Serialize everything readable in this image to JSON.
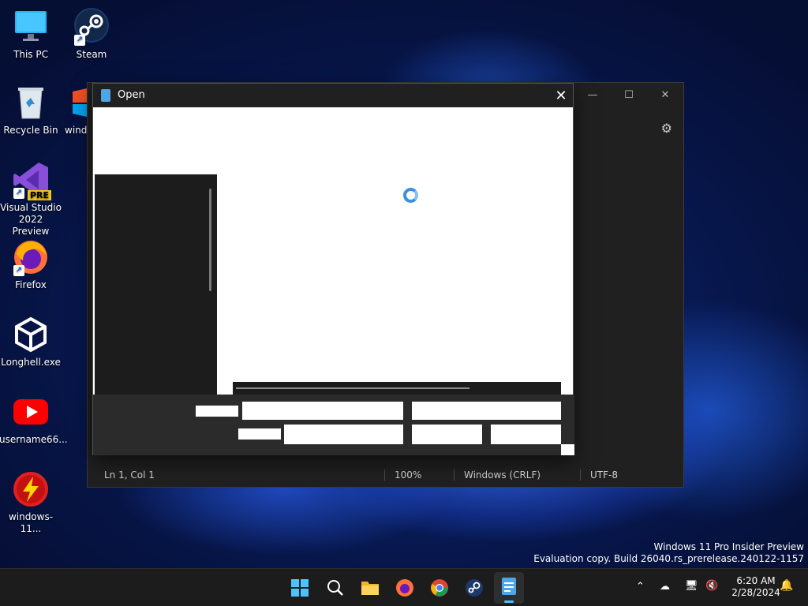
{
  "desktop": {
    "icons": [
      {
        "label": "This PC",
        "icon": "monitor-icon"
      },
      {
        "label": "Steam",
        "icon": "steam-icon"
      },
      {
        "label": "Recycle Bin",
        "icon": "recycle-bin-icon"
      },
      {
        "label": "windo",
        "icon": "windows-setup-icon"
      },
      {
        "label": "Visual Studio 2022 Preview",
        "badge": "PRE",
        "icon": "visual-studio-icon"
      },
      {
        "label": "Firefox",
        "icon": "firefox-icon"
      },
      {
        "label": "Longhell.exe",
        "icon": "unity-icon"
      },
      {
        "label": "username66...",
        "icon": "youtube-icon"
      },
      {
        "label": "windows-11...",
        "icon": "lightning-icon"
      }
    ],
    "watermark_line1": "Windows 11 Pro Insider Preview",
    "watermark_line2": "Evaluation copy. Build 26040.rs_prerelease.240122-1157"
  },
  "notepad": {
    "status_position": "Ln 1, Col 1",
    "status_zoom": "100%",
    "status_line_ending": "Windows (CRLF)",
    "status_encoding": "UTF-8"
  },
  "dialog": {
    "title": "Open"
  },
  "taskbar": {
    "time": "6:20 AM",
    "date": "2/28/2024",
    "apps": [
      "start-icon",
      "search-icon",
      "file-explorer-icon",
      "firefox-icon",
      "chrome-icon",
      "steam-icon",
      "notepad-icon"
    ]
  },
  "colors": {
    "accent": "#3b8ee0",
    "taskbar_bg": "#1c1c1c",
    "window_bg": "#202020"
  }
}
